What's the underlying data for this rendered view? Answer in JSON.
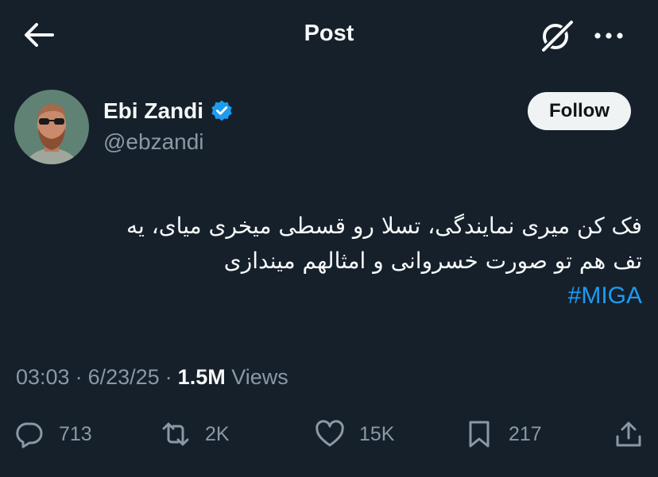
{
  "header": {
    "title": "Post",
    "back_icon": "arrow-left-icon",
    "grok_icon": "grok-icon",
    "more_icon": "more-horizontal-icon"
  },
  "author": {
    "display_name": "Ebi Zandi",
    "handle": "@ebzandi",
    "verified": true,
    "verified_color": "#1d9bf0"
  },
  "follow_label": "Follow",
  "tweet": {
    "lines": [
      "فک کن میری نمایندگی، تسلا رو قسطی میخری میای، یه",
      "تف هم تو صورت خسروانی و امثالهم میندازی"
    ],
    "hashtag": "#MIGA",
    "hashtag_color": "#1d9bf0"
  },
  "meta": {
    "time": "03:03",
    "date": "6/23/25",
    "views_count": "1.5M",
    "views_label": "Views",
    "separator": "·"
  },
  "actions": {
    "replies": "713",
    "reposts": "2K",
    "likes": "15K",
    "bookmarks": "217"
  },
  "colors": {
    "background": "#15202b",
    "text": "#f7f9f9",
    "secondary": "#8b98a5",
    "accent": "#1d9bf0"
  }
}
